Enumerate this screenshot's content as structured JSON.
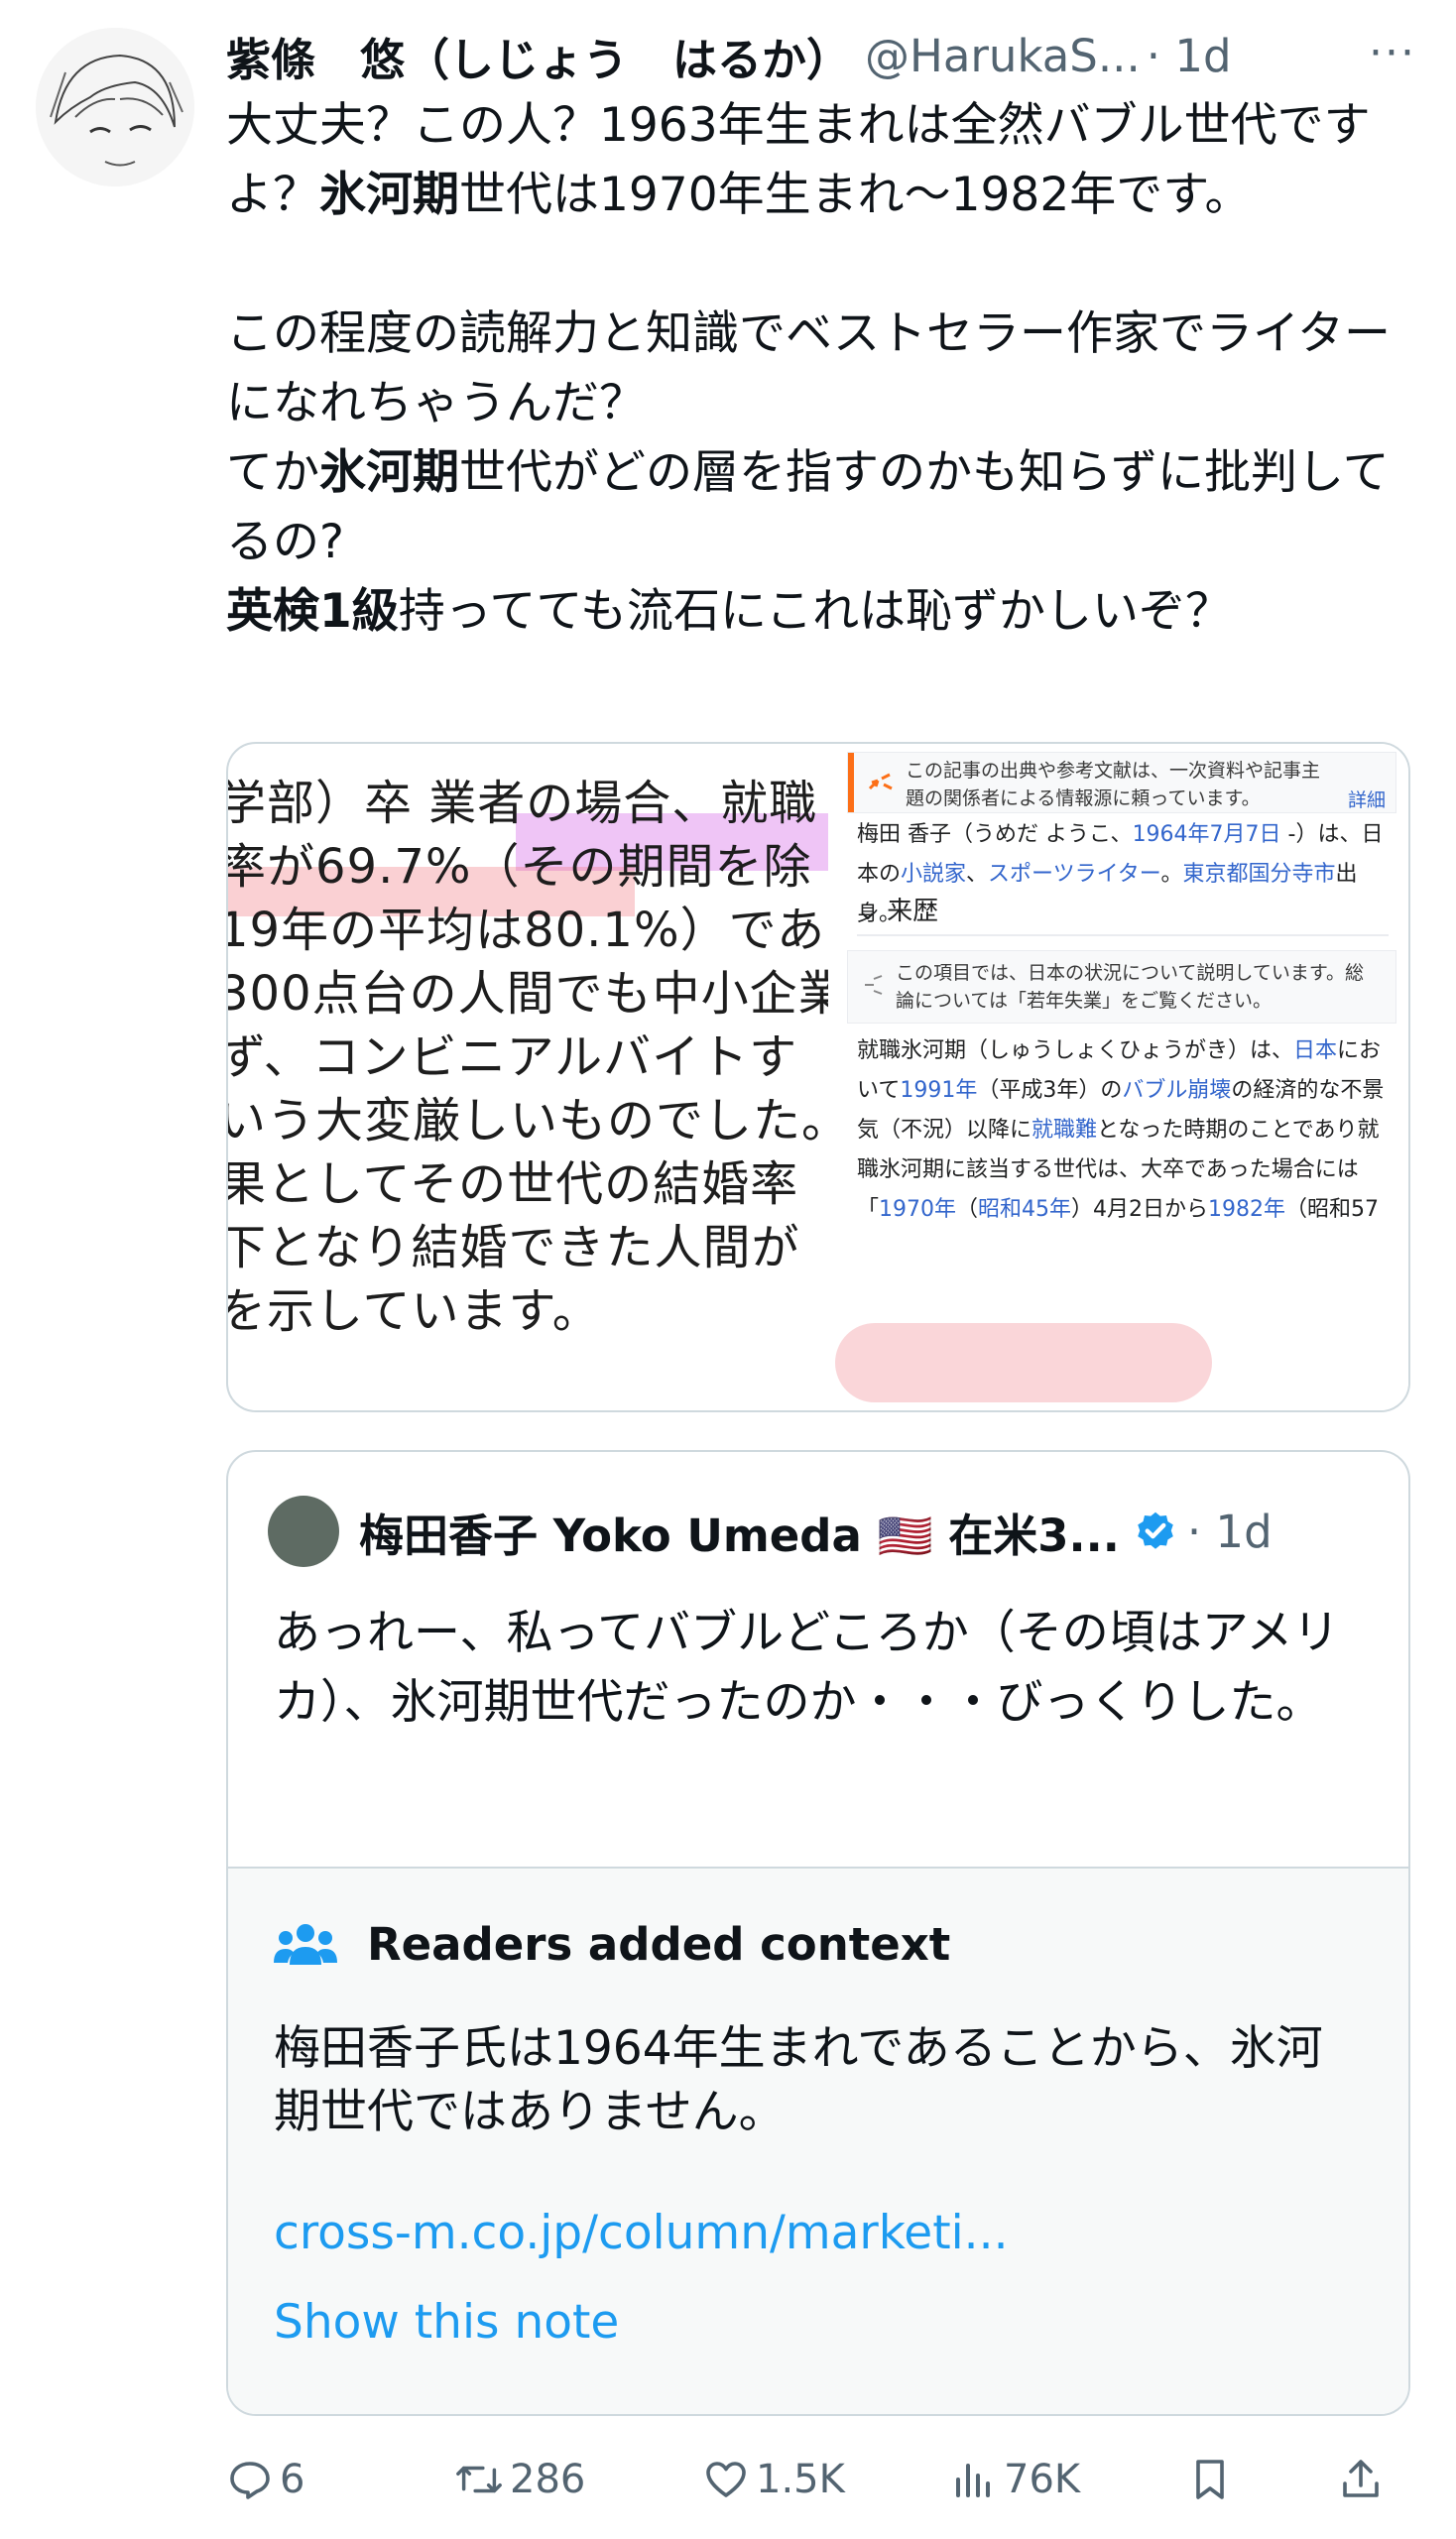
{
  "post": {
    "author_name": "紫條　悠（しじょう　はるか）",
    "handle": "@HarukaS...",
    "time": "· 1d",
    "more": "···",
    "paragraphs": [
      {
        "id": "p1",
        "segments": [
          {
            "t": "大丈夫？この人？1963年生まれは全然バブル世代ですよ？",
            "b": false
          },
          {
            "t": "氷河期",
            "b": true
          },
          {
            "t": "世代は1970年生まれ〜1982年です。",
            "b": false
          }
        ]
      },
      {
        "id": "p2",
        "segments": [
          {
            "t": "この程度の読解力と知識でベストセラー作家でライターになれちゃうんだ？",
            "b": false
          }
        ]
      },
      {
        "id": "p3",
        "segments": [
          {
            "t": "てか",
            "b": false
          },
          {
            "t": "氷河期",
            "b": true
          },
          {
            "t": "世代がどの層を指すのかも知らずに批判してるの?",
            "b": false
          }
        ]
      },
      {
        "id": "p4",
        "segments": [
          {
            "t": "英検1級",
            "b": true
          },
          {
            "t": "持ってても流石にこれは恥ずかしいぞ？",
            "b": false
          }
        ]
      }
    ]
  },
  "media": {
    "left_lines": [
      "学部）卒 業者の場合、就職",
      "率が69.7%（その期間を除",
      "19年の平均は80.1%）であ",
      "300点台の人間でも中小企業",
      "ず、コンビニアルバイトす",
      "いう大変厳しいものでした。",
      "果としてその世代の結婚率",
      "下となり結婚できた人間が",
      "を示しています。"
    ],
    "wiki": {
      "notice1": "この記事の出典や参考文献は、一次資料や記事主題の関係者による情報源に頼っています。",
      "notice1_link": "詳細",
      "intro_a": "梅田 香子（うめだ ようこ、",
      "intro_date": "1964年7月7日",
      "intro_b": " -）は、日本の",
      "intro_l1": "小説家",
      "intro_sep": "、",
      "intro_l2": "スポーツライター",
      "intro_c": "。",
      "intro_l3": "東京都国分寺市",
      "intro_d": "出身。",
      "section": "来歴",
      "notice2": "この項目では、日本の状況について説明しています。総論については「若年失業」をご覧ください。",
      "kobetsu_a": "就職氷河期（しゅうしょくひょうがき）は、",
      "kobetsu_l1": "日本",
      "kobetsu_b": "において",
      "kobetsu_l2": "1991年",
      "kobetsu_c": "（平成3年）の",
      "kobetsu_l3": "バブル崩壊",
      "kobetsu_d": "の経済的な不景気（不況）以降に",
      "kobetsu_l4": "就職難",
      "kobetsu_e": "となった時期のことであり就職氷河期に該当する世代は、大卒であった場合には「",
      "kobetsu_l5": "1970年",
      "kobetsu_f": "（",
      "kobetsu_l6": "昭和45年",
      "kobetsu_g": "）4月2日から",
      "kobetsu_l7": "1982年",
      "kobetsu_h": "（昭和57"
    }
  },
  "quote": {
    "name": "梅田香子 Yoko Umeda 🇺🇸 在米3...",
    "time": "· 1d",
    "text": "あっれー、私ってバブルどころか（その頃はアメリカ）、氷河期世代だったのか・・・びっくりした。",
    "context_title": "Readers added context",
    "context_text": "梅田香子氏は1964年生まれであることから、氷河期世代ではありません。",
    "context_link": "cross-m.co.jp/column/marketi...",
    "show_note": "Show this note"
  },
  "actions": {
    "replies": "6",
    "reposts": "286",
    "likes": "1.5K",
    "views": "76K"
  },
  "colors": {
    "link": "#1d9bf0",
    "muted": "#536471",
    "border": "#cfd9de",
    "verified": "#1d9bf0"
  }
}
